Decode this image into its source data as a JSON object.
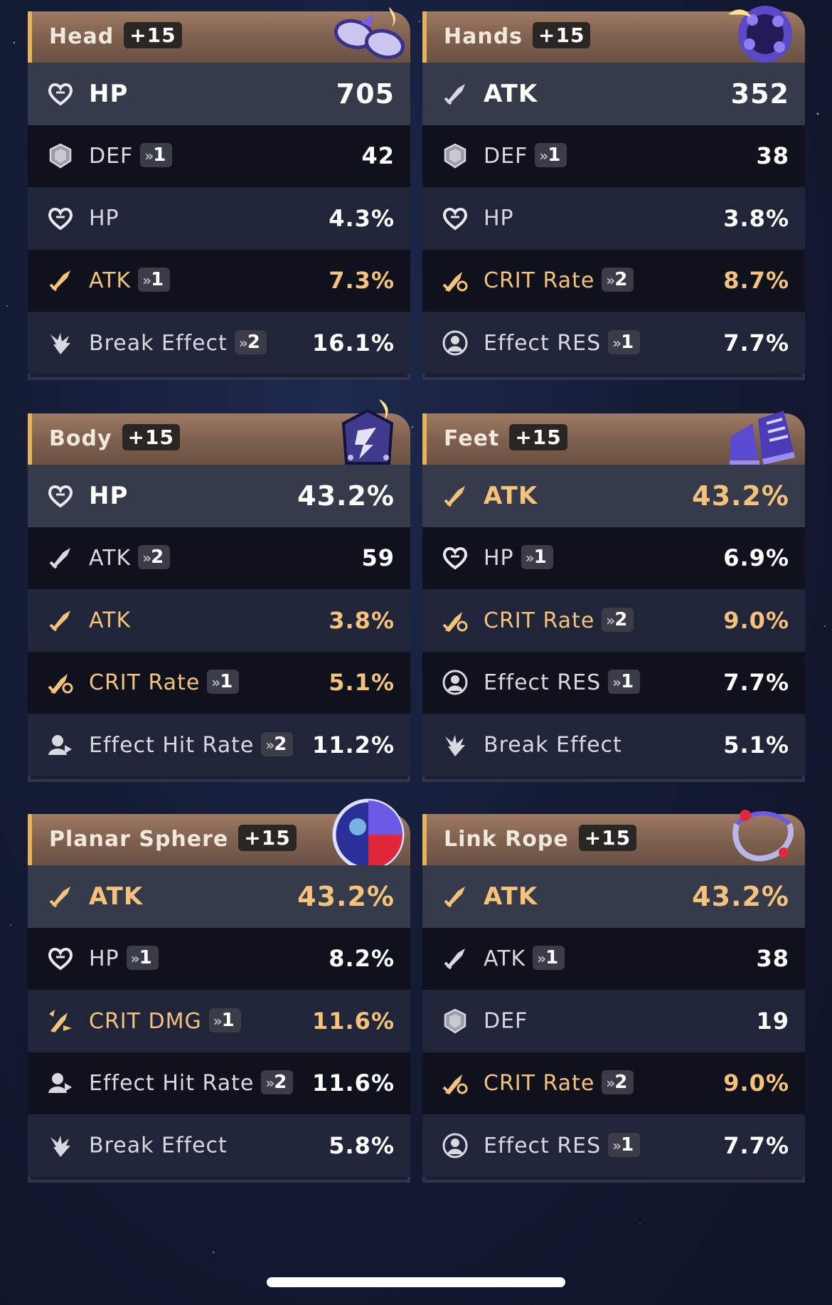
{
  "cards": [
    {
      "slot": "Head",
      "level": "+15",
      "thumb": "glasses-icon",
      "main": {
        "icon": "heart-icon",
        "label": "HP",
        "value": "705",
        "gold": false
      },
      "subs": [
        {
          "icon": "shield-icon",
          "label": "DEF",
          "roll": "1",
          "value": "42",
          "gold": false
        },
        {
          "icon": "heart-icon",
          "label": "HP",
          "roll": "",
          "value": "4.3%",
          "gold": false
        },
        {
          "icon": "sword-icon",
          "label": "ATK",
          "roll": "1",
          "value": "7.3%",
          "gold": true
        },
        {
          "icon": "break-icon",
          "label": "Break Effect",
          "roll": "2",
          "value": "16.1%",
          "gold": false
        }
      ]
    },
    {
      "slot": "Hands",
      "level": "+15",
      "thumb": "gauntlet-icon",
      "main": {
        "icon": "sword-icon",
        "label": "ATK",
        "value": "352",
        "gold": false
      },
      "subs": [
        {
          "icon": "shield-icon",
          "label": "DEF",
          "roll": "1",
          "value": "38",
          "gold": false
        },
        {
          "icon": "heart-icon",
          "label": "HP",
          "roll": "",
          "value": "3.8%",
          "gold": false
        },
        {
          "icon": "crit-rate-icon",
          "label": "CRIT Rate",
          "roll": "2",
          "value": "8.7%",
          "gold": true
        },
        {
          "icon": "effect-res-icon",
          "label": "Effect RES",
          "roll": "1",
          "value": "7.7%",
          "gold": false
        }
      ]
    },
    {
      "slot": "Body",
      "level": "+15",
      "thumb": "armor-icon",
      "main": {
        "icon": "heart-icon",
        "label": "HP",
        "value": "43.2%",
        "gold": false
      },
      "subs": [
        {
          "icon": "sword-icon",
          "label": "ATK",
          "roll": "2",
          "value": "59",
          "gold": false
        },
        {
          "icon": "sword-icon",
          "label": "ATK",
          "roll": "",
          "value": "3.8%",
          "gold": true
        },
        {
          "icon": "crit-rate-icon",
          "label": "CRIT Rate",
          "roll": "1",
          "value": "5.1%",
          "gold": true
        },
        {
          "icon": "effect-hit-icon",
          "label": "Effect Hit Rate",
          "roll": "2",
          "value": "11.2%",
          "gold": false
        }
      ]
    },
    {
      "slot": "Feet",
      "level": "+15",
      "thumb": "boots-icon",
      "main": {
        "icon": "sword-icon",
        "label": "ATK",
        "value": "43.2%",
        "gold": true
      },
      "subs": [
        {
          "icon": "heart-icon",
          "label": "HP",
          "roll": "1",
          "value": "6.9%",
          "gold": false
        },
        {
          "icon": "crit-rate-icon",
          "label": "CRIT Rate",
          "roll": "2",
          "value": "9.0%",
          "gold": true
        },
        {
          "icon": "effect-res-icon",
          "label": "Effect RES",
          "roll": "1",
          "value": "7.7%",
          "gold": false
        },
        {
          "icon": "break-icon",
          "label": "Break Effect",
          "roll": "",
          "value": "5.1%",
          "gold": false
        }
      ]
    },
    {
      "slot": "Planar Sphere",
      "level": "+15",
      "thumb": "sphere-icon",
      "main": {
        "icon": "sword-icon",
        "label": "ATK",
        "value": "43.2%",
        "gold": true
      },
      "subs": [
        {
          "icon": "heart-icon",
          "label": "HP",
          "roll": "1",
          "value": "8.2%",
          "gold": false
        },
        {
          "icon": "crit-dmg-icon",
          "label": "CRIT DMG",
          "roll": "1",
          "value": "11.6%",
          "gold": true
        },
        {
          "icon": "effect-hit-icon",
          "label": "Effect Hit Rate",
          "roll": "2",
          "value": "11.6%",
          "gold": false
        },
        {
          "icon": "break-icon",
          "label": "Break Effect",
          "roll": "",
          "value": "5.8%",
          "gold": false
        }
      ]
    },
    {
      "slot": "Link Rope",
      "level": "+15",
      "thumb": "rope-icon",
      "main": {
        "icon": "sword-icon",
        "label": "ATK",
        "value": "43.2%",
        "gold": true
      },
      "subs": [
        {
          "icon": "sword-icon",
          "label": "ATK",
          "roll": "1",
          "value": "38",
          "gold": false
        },
        {
          "icon": "shield-icon",
          "label": "DEF",
          "roll": "",
          "value": "19",
          "gold": false
        },
        {
          "icon": "crit-rate-icon",
          "label": "CRIT Rate",
          "roll": "2",
          "value": "9.0%",
          "gold": true
        },
        {
          "icon": "effect-res-icon",
          "label": "Effect RES",
          "roll": "1",
          "value": "7.7%",
          "gold": false
        }
      ]
    }
  ],
  "colors": {
    "gold": "#f5c27a",
    "header_accent": "#e8b25a",
    "panel_dark": "#0f121c",
    "panel_light": "#21253a"
  }
}
